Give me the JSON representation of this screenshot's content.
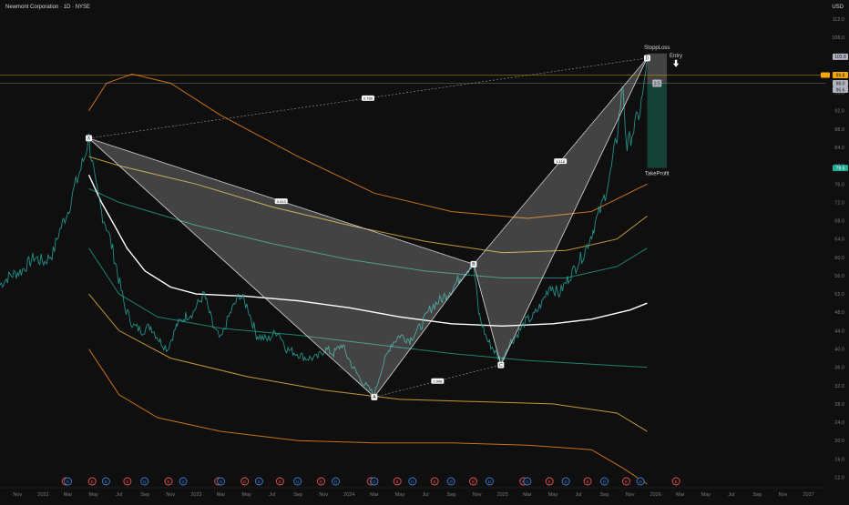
{
  "chart_data": {
    "type": "line",
    "title": "Newmont Corporation · 1D · NYSE",
    "currency": "USD",
    "y_ticks": [
      12,
      16,
      20,
      24,
      28,
      32,
      36,
      40,
      44,
      48,
      52,
      56,
      60,
      64,
      68,
      72,
      76,
      80,
      84,
      88,
      92,
      96,
      100,
      104,
      108,
      112
    ],
    "ylim": [
      10.5,
      113
    ],
    "x_ticks": [
      {
        "label": "Nov",
        "date": "2021-11-01"
      },
      {
        "label": "2022",
        "date": "2022-01-01"
      },
      {
        "label": "Mar",
        "date": "2022-03-01"
      },
      {
        "label": "May",
        "date": "2022-05-01"
      },
      {
        "label": "Jul",
        "date": "2022-07-01"
      },
      {
        "label": "Sep",
        "date": "2022-09-01"
      },
      {
        "label": "Nov",
        "date": "2022-11-01"
      },
      {
        "label": "2023",
        "date": "2023-01-01"
      },
      {
        "label": "Mar",
        "date": "2023-03-01"
      },
      {
        "label": "May",
        "date": "2023-05-01"
      },
      {
        "label": "Jul",
        "date": "2023-07-01"
      },
      {
        "label": "Sep",
        "date": "2023-09-01"
      },
      {
        "label": "Nov",
        "date": "2023-11-01"
      },
      {
        "label": "2024",
        "date": "2024-01-01"
      },
      {
        "label": "Mar",
        "date": "2024-03-01"
      },
      {
        "label": "May",
        "date": "2024-05-01"
      },
      {
        "label": "Jul",
        "date": "2024-07-01"
      },
      {
        "label": "Sep",
        "date": "2024-09-01"
      },
      {
        "label": "Nov",
        "date": "2024-11-01"
      },
      {
        "label": "2025",
        "date": "2025-01-01"
      },
      {
        "label": "Mar",
        "date": "2025-03-01"
      },
      {
        "label": "May",
        "date": "2025-05-01"
      },
      {
        "label": "Jul",
        "date": "2025-07-01"
      },
      {
        "label": "Sep",
        "date": "2025-09-01"
      },
      {
        "label": "Nov",
        "date": "2025-11-01"
      },
      {
        "label": "2026",
        "date": "2026-01-01"
      },
      {
        "label": "Mar",
        "date": "2026-03-01"
      },
      {
        "label": "May",
        "date": "2026-05-01"
      },
      {
        "label": "Jul",
        "date": "2026-07-01"
      },
      {
        "label": "Sep",
        "date": "2026-09-01"
      },
      {
        "label": "Nov",
        "date": "2026-11-01"
      },
      {
        "label": "2027",
        "date": "2027-01-01"
      }
    ],
    "xlim": [
      "2021-09-20",
      "2027-02-10"
    ],
    "price_series": {
      "name": "",
      "color": "#26a69a",
      "points": [
        [
          "2021-09-20",
          54
        ],
        [
          "2021-10-15",
          56
        ],
        [
          "2021-11-10",
          57
        ],
        [
          "2021-12-10",
          60
        ],
        [
          "2022-01-05",
          59
        ],
        [
          "2022-01-25",
          61
        ],
        [
          "2022-02-10",
          66
        ],
        [
          "2022-03-01",
          70
        ],
        [
          "2022-03-20",
          76
        ],
        [
          "2022-04-10",
          82
        ],
        [
          "2022-04-20",
          86
        ],
        [
          "2022-05-05",
          76
        ],
        [
          "2022-05-20",
          70
        ],
        [
          "2022-06-05",
          66
        ],
        [
          "2022-06-25",
          58
        ],
        [
          "2022-07-15",
          49
        ],
        [
          "2022-08-05",
          45
        ],
        [
          "2022-08-25",
          44
        ],
        [
          "2022-09-15",
          45
        ],
        [
          "2022-10-05",
          42
        ],
        [
          "2022-10-25",
          40
        ],
        [
          "2022-11-15",
          45
        ],
        [
          "2022-12-05",
          47
        ],
        [
          "2022-12-25",
          48
        ],
        [
          "2023-01-20",
          52
        ],
        [
          "2023-02-10",
          45
        ],
        [
          "2023-03-01",
          42
        ],
        [
          "2023-03-20",
          47
        ],
        [
          "2023-04-15",
          52
        ],
        [
          "2023-05-05",
          49
        ],
        [
          "2023-05-25",
          43
        ],
        [
          "2023-06-20",
          42
        ],
        [
          "2023-07-15",
          44
        ],
        [
          "2023-08-05",
          40
        ],
        [
          "2023-08-30",
          39
        ],
        [
          "2023-09-20",
          38
        ],
        [
          "2023-10-15",
          38
        ],
        [
          "2023-11-05",
          40
        ],
        [
          "2023-11-25",
          39
        ],
        [
          "2023-12-15",
          41
        ],
        [
          "2024-01-10",
          36
        ],
        [
          "2024-02-01",
          33
        ],
        [
          "2024-02-20",
          31
        ],
        [
          "2024-03-01",
          30
        ],
        [
          "2024-03-20",
          36
        ],
        [
          "2024-04-10",
          41
        ],
        [
          "2024-05-01",
          43
        ],
        [
          "2024-05-25",
          42
        ],
        [
          "2024-06-20",
          45
        ],
        [
          "2024-07-15",
          49
        ],
        [
          "2024-08-10",
          51
        ],
        [
          "2024-09-01",
          53
        ],
        [
          "2024-09-25",
          56
        ],
        [
          "2024-10-15",
          58
        ],
        [
          "2024-10-24",
          58
        ],
        [
          "2024-11-05",
          48
        ],
        [
          "2024-11-25",
          42
        ],
        [
          "2024-12-10",
          40
        ],
        [
          "2024-12-30",
          37
        ],
        [
          "2025-01-15",
          41
        ],
        [
          "2025-02-05",
          43
        ],
        [
          "2025-02-25",
          46
        ],
        [
          "2025-03-15",
          47
        ],
        [
          "2025-04-05",
          50
        ],
        [
          "2025-04-25",
          54
        ],
        [
          "2025-05-15",
          52
        ],
        [
          "2025-06-05",
          55
        ],
        [
          "2025-06-25",
          58
        ],
        [
          "2025-07-15",
          61
        ],
        [
          "2025-08-05",
          66
        ],
        [
          "2025-08-25",
          71
        ],
        [
          "2025-09-15",
          78
        ],
        [
          "2025-10-01",
          86
        ],
        [
          "2025-10-15",
          98
        ],
        [
          "2025-10-25",
          84
        ],
        [
          "2025-11-10",
          88
        ],
        [
          "2025-11-25",
          92
        ],
        [
          "2025-12-05",
          97
        ],
        [
          "2025-12-12",
          103
        ]
      ]
    },
    "moving_average": {
      "name": "",
      "color": "#ffffff",
      "points": [
        [
          "2022-04-20",
          78
        ],
        [
          "2022-05-20",
          72
        ],
        [
          "2022-06-20",
          67
        ],
        [
          "2022-07-20",
          62
        ],
        [
          "2022-09-01",
          57
        ],
        [
          "2022-11-01",
          53.5
        ],
        [
          "2023-01-01",
          52
        ],
        [
          "2023-05-01",
          51.5
        ],
        [
          "2023-09-01",
          50.5
        ],
        [
          "2024-01-01",
          49
        ],
        [
          "2024-05-01",
          47
        ],
        [
          "2024-09-01",
          45.5
        ],
        [
          "2025-01-01",
          45
        ],
        [
          "2025-05-01",
          45.5
        ],
        [
          "2025-08-01",
          46.5
        ],
        [
          "2025-11-01",
          48.5
        ],
        [
          "2025-12-12",
          50
        ]
      ]
    },
    "bands": [
      {
        "name": "",
        "color": "#e07b1a",
        "points": [
          [
            "2022-04-20",
            92
          ],
          [
            "2022-06-01",
            98
          ],
          [
            "2022-08-01",
            100
          ],
          [
            "2022-11-01",
            98
          ],
          [
            "2023-03-01",
            91
          ],
          [
            "2023-09-01",
            82
          ],
          [
            "2024-03-01",
            74
          ],
          [
            "2024-09-01",
            70
          ],
          [
            "2025-03-01",
            68.5
          ],
          [
            "2025-08-01",
            70
          ],
          [
            "2025-12-12",
            76
          ]
        ]
      },
      {
        "name": "",
        "color": "#d4a83a",
        "points": [
          [
            "2022-04-20",
            82
          ],
          [
            "2022-07-01",
            80
          ],
          [
            "2023-01-01",
            76
          ],
          [
            "2023-07-01",
            71
          ],
          [
            "2024-01-01",
            67
          ],
          [
            "2024-07-01",
            63.5
          ],
          [
            "2025-01-01",
            61
          ],
          [
            "2025-06-01",
            61.5
          ],
          [
            "2025-10-01",
            64
          ],
          [
            "2025-12-12",
            69
          ]
        ]
      },
      {
        "name": "",
        "color": "#1f8f7a",
        "points": [
          [
            "2022-04-20",
            75
          ],
          [
            "2022-07-01",
            72
          ],
          [
            "2023-01-01",
            67
          ],
          [
            "2023-07-01",
            63
          ],
          [
            "2024-01-01",
            59.5
          ],
          [
            "2024-07-01",
            57
          ],
          [
            "2025-01-01",
            55.5
          ],
          [
            "2025-06-01",
            55.5
          ],
          [
            "2025-10-01",
            58
          ],
          [
            "2025-12-12",
            62
          ]
        ]
      },
      {
        "name": "",
        "color": "#1f8f7a",
        "points": [
          [
            "2022-04-20",
            62
          ],
          [
            "2022-07-01",
            52
          ],
          [
            "2022-10-01",
            47
          ],
          [
            "2023-03-01",
            44.5
          ],
          [
            "2023-09-01",
            43
          ],
          [
            "2024-03-01",
            41
          ],
          [
            "2024-09-01",
            39
          ],
          [
            "2025-03-01",
            37.5
          ],
          [
            "2025-09-01",
            36.5
          ],
          [
            "2025-12-12",
            36
          ]
        ]
      },
      {
        "name": "",
        "color": "#d4a83a",
        "points": [
          [
            "2022-04-20",
            52
          ],
          [
            "2022-07-01",
            44
          ],
          [
            "2022-11-01",
            38
          ],
          [
            "2023-05-01",
            34
          ],
          [
            "2023-11-01",
            31
          ],
          [
            "2024-05-01",
            29
          ],
          [
            "2024-11-01",
            28.5
          ],
          [
            "2025-05-01",
            28
          ],
          [
            "2025-10-01",
            26
          ],
          [
            "2025-12-12",
            22
          ]
        ]
      },
      {
        "name": "",
        "color": "#e07b1a",
        "points": [
          [
            "2022-04-20",
            40
          ],
          [
            "2022-07-01",
            30
          ],
          [
            "2022-10-01",
            25
          ],
          [
            "2023-03-01",
            22
          ],
          [
            "2023-09-01",
            20
          ],
          [
            "2024-03-01",
            19.5
          ],
          [
            "2024-09-01",
            19.5
          ],
          [
            "2025-03-01",
            19
          ],
          [
            "2025-08-01",
            18
          ],
          [
            "2025-10-15",
            14
          ],
          [
            "2025-12-12",
            10.5
          ]
        ]
      }
    ],
    "pattern": {
      "points": [
        {
          "label": "X",
          "date": "2022-04-20",
          "value": 86
        },
        {
          "label": "A",
          "date": "2024-03-01",
          "value": 29.5
        },
        {
          "label": "B",
          "date": "2024-10-24",
          "value": 58.5
        },
        {
          "label": "C",
          "date": "2024-12-28",
          "value": 36.5
        },
        {
          "label": "D",
          "date": "2025-12-12",
          "value": 103.5
        }
      ],
      "ratios": [
        {
          "label": "0.513",
          "value": 0.513
        },
        {
          "label": "2.948",
          "value": 2.948
        },
        {
          "label": "1.116",
          "value": 1.116
        },
        {
          "label": "0.786",
          "value": 0.786
        }
      ]
    },
    "position": {
      "stop_label": "StoppLoss",
      "target_label": "TakeProfit",
      "entry_label": "Entry",
      "ratio_label": "3.5",
      "stop": 104.5,
      "entry": 98,
      "target": 79.5,
      "start": "2025-12-12",
      "end": "2026-01-28"
    },
    "price_labels": [
      {
        "text": "103.8",
        "value": 103.8,
        "color": "#b2b5be",
        "text_color": "#131722"
      },
      {
        "text": "99.8",
        "value": 99.8,
        "color": "#f7a600",
        "text_color": "#131722"
      },
      {
        "text": "98.0",
        "value": 98.0,
        "color": "#b2b5be",
        "text_color": "#131722"
      },
      {
        "text": "96.6",
        "value": 96.6,
        "color": "#b2b5be",
        "text_color": "#131722"
      },
      {
        "text": "79.5",
        "value": 79.5,
        "color": "#22ab94",
        "text_color": "#ffffff"
      }
    ],
    "events": [
      {
        "type": "E",
        "date": "2022-02-24"
      },
      {
        "type": "D",
        "date": "2022-03-01"
      },
      {
        "type": "E",
        "date": "2022-04-28"
      },
      {
        "type": "D",
        "date": "2022-05-31"
      },
      {
        "type": "E",
        "date": "2022-07-21"
      },
      {
        "type": "D",
        "date": "2022-08-31"
      },
      {
        "type": "E",
        "date": "2022-10-27"
      },
      {
        "type": "D",
        "date": "2022-12-01"
      },
      {
        "type": "E",
        "date": "2023-02-23"
      },
      {
        "type": "D",
        "date": "2023-03-01"
      },
      {
        "type": "E",
        "date": "2023-04-27"
      },
      {
        "type": "D",
        "date": "2023-05-31"
      },
      {
        "type": "E",
        "date": "2023-07-20"
      },
      {
        "type": "D",
        "date": "2023-08-31"
      },
      {
        "type": "E",
        "date": "2023-10-26"
      },
      {
        "type": "D",
        "date": "2023-11-30"
      },
      {
        "type": "E",
        "date": "2024-02-22"
      },
      {
        "type": "D",
        "date": "2024-03-01"
      },
      {
        "type": "E",
        "date": "2024-04-25"
      },
      {
        "type": "D",
        "date": "2024-05-31"
      },
      {
        "type": "E",
        "date": "2024-07-23"
      },
      {
        "type": "D",
        "date": "2024-08-31"
      },
      {
        "type": "E",
        "date": "2024-10-23"
      },
      {
        "type": "D",
        "date": "2024-12-01"
      },
      {
        "type": "E",
        "date": "2025-02-20"
      },
      {
        "type": "D",
        "date": "2025-03-01"
      },
      {
        "type": "E",
        "date": "2025-04-23"
      },
      {
        "type": "D",
        "date": "2025-06-01"
      },
      {
        "type": "E",
        "date": "2025-07-23"
      },
      {
        "type": "D",
        "date": "2025-09-01"
      },
      {
        "type": "E",
        "date": "2025-10-23"
      },
      {
        "type": "D",
        "date": "2025-11-26"
      },
      {
        "type": "E",
        "date": "2026-02-19"
      }
    ]
  }
}
